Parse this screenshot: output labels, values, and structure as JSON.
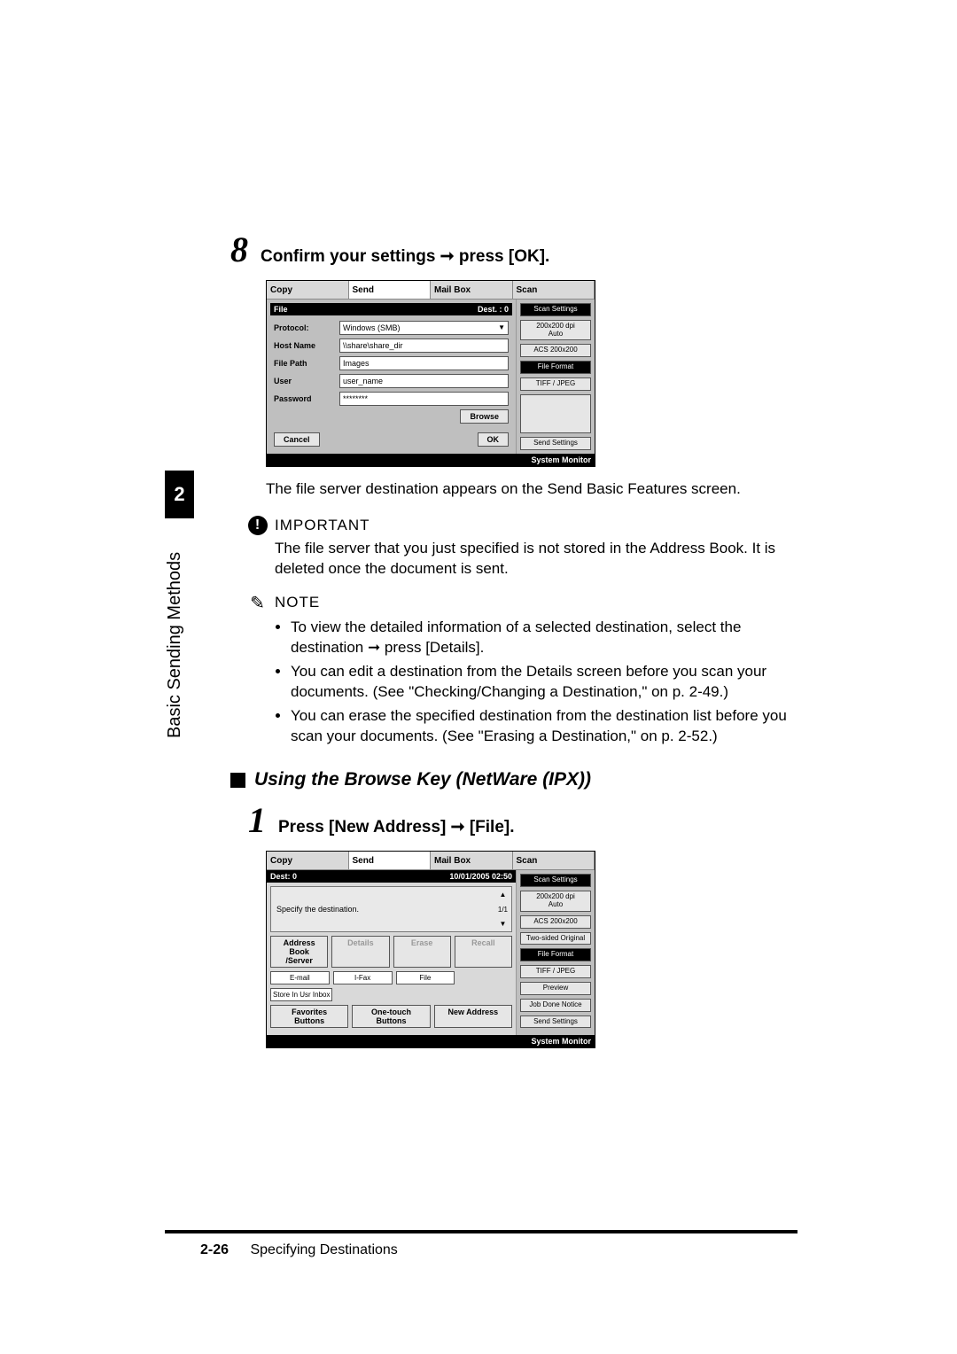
{
  "side_tab": {
    "chapter": "2",
    "title": "Basic Sending Methods"
  },
  "step8": {
    "num": "8",
    "text": "Confirm your settings ➞ press [OK].",
    "after_para": "The file server destination appears on the Send Basic Features screen."
  },
  "screenshot1": {
    "tabs": {
      "copy": "Copy",
      "send": "Send",
      "mailbox": "Mail Box",
      "scan": "Scan"
    },
    "bar": {
      "title": "File",
      "dest": "Dest. : 0"
    },
    "fields": {
      "protocol": {
        "label": "Protocol:",
        "value": "Windows (SMB)"
      },
      "host": {
        "label": "Host Name",
        "value": "\\\\share\\share_dir"
      },
      "path": {
        "label": "File Path",
        "value": "Images"
      },
      "user": {
        "label": "User",
        "value": "user_name"
      },
      "pass": {
        "label": "Password",
        "value": "********"
      }
    },
    "buttons": {
      "browse": "Browse",
      "cancel": "Cancel",
      "ok": "OK"
    },
    "side": {
      "scan_settings": "Scan Settings",
      "dpi": "200x200 dpi",
      "auto": "Auto",
      "acs": "ACS 200x200",
      "file_format": "File Format",
      "tiff_jpeg": "TIFF / JPEG",
      "send_settings": "Send Settings"
    },
    "sysbar": "System Monitor"
  },
  "important": {
    "label": "IMPORTANT",
    "text": "The file server that you just specified is not stored in the Address Book. It is deleted once the document is sent."
  },
  "note": {
    "label": "NOTE",
    "items": [
      "To view the detailed information of a selected destination, select the destination ➞ press [Details].",
      "You can edit a destination from the Details screen before you scan your documents. (See \"Checking/Changing a Destination,\" on p. 2-49.)",
      "You can erase the specified destination from the destination list before you scan your documents. (See \"Erasing a Destination,\" on p. 2-52.)"
    ]
  },
  "subheading": "Using the Browse Key (NetWare (IPX))",
  "step1": {
    "num": "1",
    "text": "Press [New Address] ➞ [File]."
  },
  "screenshot2": {
    "tabs": {
      "copy": "Copy",
      "send": "Send",
      "mailbox": "Mail Box",
      "scan": "Scan"
    },
    "statusbar": {
      "dest": "Dest: 0",
      "datetime": "10/01/2005 02:50"
    },
    "hint": "Specify the destination.",
    "pager": "1/1",
    "row1": {
      "addrbook": "Address Book /Server",
      "details": "Details",
      "erase": "Erase",
      "recall": "Recall"
    },
    "row2": {
      "email": "E-mail",
      "ifax": "I-Fax",
      "file": "File"
    },
    "row3": {
      "store": "Store In Usr Inbox"
    },
    "row4": {
      "fav": "Favorites Buttons",
      "onetouch": "One-touch Buttons",
      "newaddr": "New Address"
    },
    "side": {
      "scan_settings": "Scan Settings",
      "dpi": "200x200 dpi",
      "auto": "Auto",
      "acs": "ACS 200x200",
      "twosided": "Two-sided Original",
      "file_format": "File Format",
      "tiff_jpeg": "TIFF / JPEG",
      "preview": "Preview",
      "jobdone": "Job Done Notice",
      "send_settings": "Send Settings"
    },
    "sysbar": "System Monitor"
  },
  "footer": {
    "page": "2-26",
    "section": "Specifying Destinations"
  }
}
